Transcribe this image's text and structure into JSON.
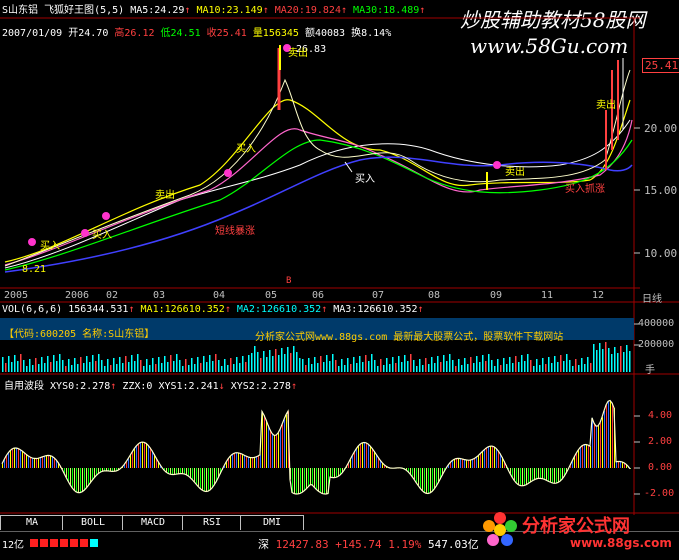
{
  "header": {
    "stock_name": "S山东铝",
    "indicator_name": "飞狐好王图",
    "params": "(5,5)",
    "ma5": "MA5:24.29",
    "ma10": "MA10:23.149",
    "ma20": "MA20:19.824",
    "ma30": "MA30:18.489"
  },
  "info_row": {
    "date": "2007/01/09",
    "open": "开24.70",
    "high": "高26.12",
    "low": "低24.51",
    "close": "收25.41",
    "volume": "量156345",
    "amount": "额40083",
    "turnover": "换8.14%"
  },
  "watermark": {
    "title": "炒股辅助教材58股网",
    "url": "www.58Gu.com"
  },
  "price_axis": {
    "labels": [
      "25.41",
      "20.00",
      "15.00",
      "10.00"
    ]
  },
  "price_annotations": {
    "low_price": "8.21",
    "high_label": "26.83",
    "sell_1": "卖出",
    "sell_2": "卖出",
    "sell_3": "卖出",
    "sell_4": "卖出",
    "buy_1": "买入",
    "buy_2": "买入",
    "buy_3": "买入",
    "buy_4": "买入",
    "short_surge": "短线暴涨",
    "strong_buy": "买入抓涨",
    "b_marker": "B"
  },
  "time_axis": {
    "months": [
      "2005",
      "2006",
      "02",
      "03",
      "04",
      "05",
      "06",
      "07",
      "08",
      "09",
      "11",
      "12"
    ],
    "unit": "日线"
  },
  "volume_panel": {
    "title": "VOL(6,6,6)",
    "value": "156344.531",
    "ma1": "MA1:126610.352",
    "ma2": "MA2:126610.352",
    "ma3": "MA3:126610.352",
    "banner_code": "【代码:600205  名称:S山东铝】",
    "banner_ad": "分析家公式网www.88gs.com 最新最大股票公式，股票软件下载网站",
    "axis_labels": [
      "400000",
      "200000",
      "手"
    ]
  },
  "wave_panel": {
    "title": "自用波段",
    "xys0": "XYS0:2.278",
    "zzx": "ZZX:0",
    "xys1": "XYS1:2.241",
    "xys2": "XYS2:2.278",
    "axis_labels": [
      "4.00",
      "2.00",
      "0.00",
      "-2.00"
    ]
  },
  "tabs": [
    "MA",
    "BOLL",
    "MACD",
    "RSI",
    "DMI"
  ],
  "status_bar": {
    "left_value": "12亿",
    "index_name": "深",
    "index_value": "12427.83",
    "change": "+145.74",
    "change_pct": "1.19%",
    "amount": "547.03亿"
  },
  "logo": {
    "name": "分析家公式网",
    "url": "www.88gs.com"
  },
  "colors": {
    "ma_red": "#ff4040",
    "ma_green": "#00ff00",
    "volume_bar": "#00ffff",
    "banner_bg": "#003a6a",
    "axis": "#c0c0c0"
  }
}
